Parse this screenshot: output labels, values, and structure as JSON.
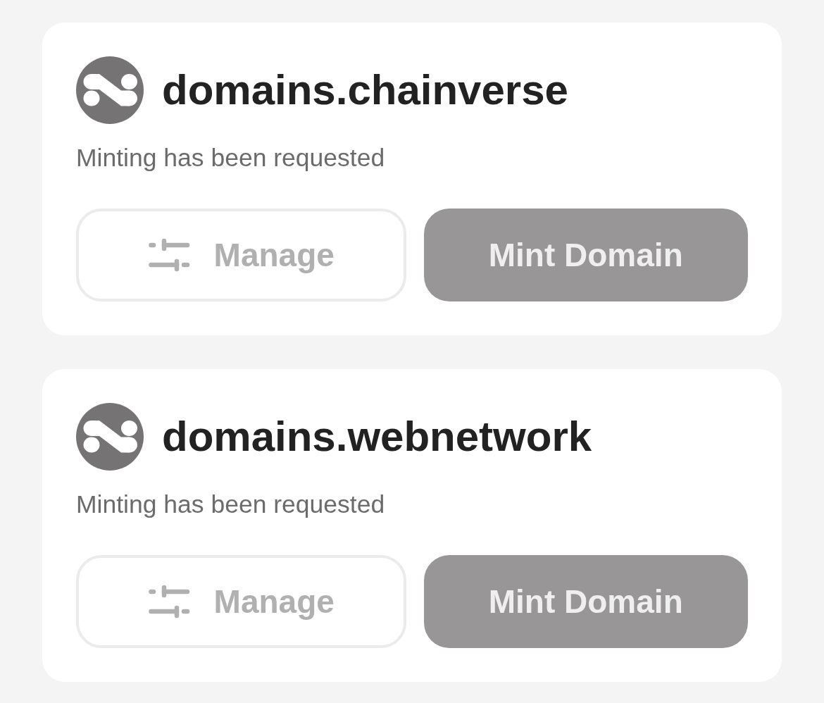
{
  "cards": [
    {
      "name": "domains.chainverse",
      "status": "Minting has been requested",
      "buttons": [
        {
          "kind": "secondary",
          "label": "Manage",
          "disabled": true
        },
        {
          "kind": "primary",
          "label": "Mint Domain",
          "disabled": true
        }
      ]
    },
    {
      "name": "domains.webnetwork",
      "status": "Minting has been requested",
      "buttons": [
        {
          "kind": "secondary",
          "label": "Manage",
          "disabled": true
        },
        {
          "kind": "primary",
          "label": "Mint Domain",
          "disabled": true
        }
      ]
    }
  ]
}
